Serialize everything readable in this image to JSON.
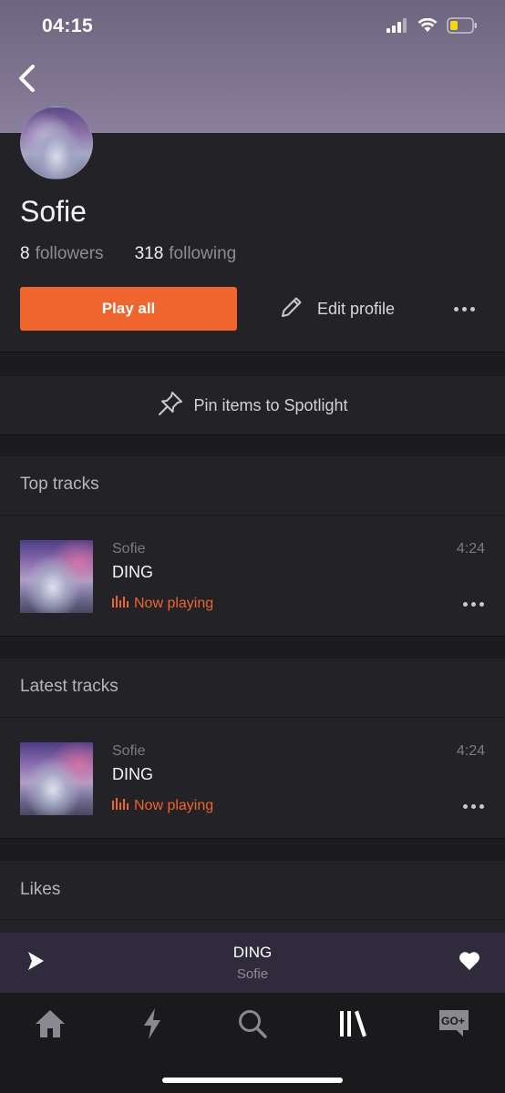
{
  "status_bar": {
    "time": "04:15"
  },
  "profile": {
    "name": "Sofie",
    "followers_count": "8",
    "followers_label": "followers",
    "following_count": "318",
    "following_label": "following"
  },
  "actions": {
    "play_all_label": "Play all",
    "edit_profile_label": "Edit profile"
  },
  "spotlight": {
    "pin_label": "Pin items to Spotlight"
  },
  "sections": {
    "top_tracks_title": "Top tracks",
    "latest_tracks_title": "Latest tracks",
    "likes_title": "Likes"
  },
  "top_tracks": [
    {
      "artist": "Sofie",
      "title": "DING",
      "duration": "4:24",
      "status": "Now playing"
    }
  ],
  "latest_tracks": [
    {
      "artist": "Sofie",
      "title": "DING",
      "duration": "4:24",
      "status": "Now playing"
    }
  ],
  "mini_player": {
    "title": "DING",
    "artist": "Sofie"
  },
  "tabs": [
    {
      "icon": "home-icon",
      "active": false
    },
    {
      "icon": "stream-lightning-icon",
      "active": false
    },
    {
      "icon": "search-icon",
      "active": false
    },
    {
      "icon": "library-icon",
      "active": true
    },
    {
      "icon": "go-plus-icon",
      "active": false
    }
  ],
  "colors": {
    "accent": "#f0642d",
    "background": "#232226",
    "header_gradient_top": "#6d6580",
    "mini_player_bg": "#302a3d"
  }
}
